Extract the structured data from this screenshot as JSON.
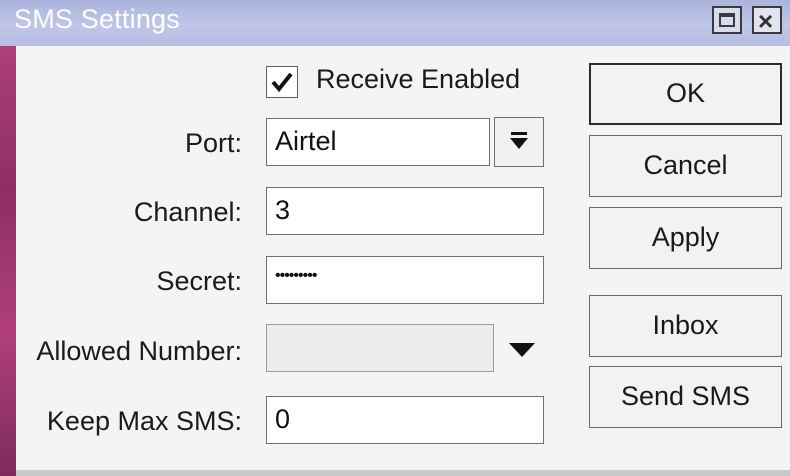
{
  "window": {
    "title": "SMS Settings"
  },
  "form": {
    "receive_enabled": {
      "label": "Receive Enabled",
      "checked": true
    },
    "port": {
      "label": "Port:",
      "value": "Airtel"
    },
    "channel": {
      "label": "Channel:",
      "value": "3"
    },
    "secret": {
      "label": "Secret:",
      "value": "•••••••••"
    },
    "allowed_number": {
      "label": "Allowed Number:",
      "value": ""
    },
    "keep_max_sms": {
      "label": "Keep Max SMS:",
      "value": "0"
    }
  },
  "buttons": {
    "ok": "OK",
    "cancel": "Cancel",
    "apply": "Apply",
    "inbox": "Inbox",
    "send_sms": "Send SMS"
  }
}
